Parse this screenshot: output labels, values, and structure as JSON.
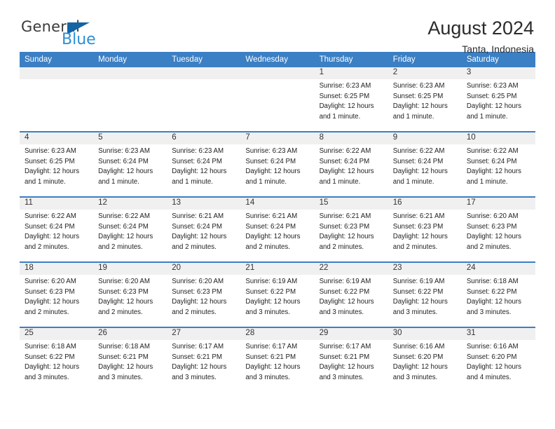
{
  "logo": {
    "word_one": "General",
    "word_two": "Blue",
    "flag_icon": "blue-triangle-flag-icon",
    "color_dark": "#3b3b3b",
    "color_flag": "#1464a5",
    "color_blue": "#2f8fd4"
  },
  "header": {
    "title": "August 2024",
    "location": "Tanta, Indonesia"
  },
  "theme": {
    "header_band": "#3b7fc4",
    "daynum_band": "#f0f0f0",
    "row_divider": "#3b7fc4"
  },
  "calendar": {
    "day_headers": [
      "Sunday",
      "Monday",
      "Tuesday",
      "Wednesday",
      "Thursday",
      "Friday",
      "Saturday"
    ],
    "weeks": [
      [
        {
          "day": ""
        },
        {
          "day": ""
        },
        {
          "day": ""
        },
        {
          "day": ""
        },
        {
          "day": "1",
          "sunrise": "Sunrise: 6:23 AM",
          "sunset": "Sunset: 6:25 PM",
          "daylight": "Daylight: 12 hours and 1 minute."
        },
        {
          "day": "2",
          "sunrise": "Sunrise: 6:23 AM",
          "sunset": "Sunset: 6:25 PM",
          "daylight": "Daylight: 12 hours and 1 minute."
        },
        {
          "day": "3",
          "sunrise": "Sunrise: 6:23 AM",
          "sunset": "Sunset: 6:25 PM",
          "daylight": "Daylight: 12 hours and 1 minute."
        }
      ],
      [
        {
          "day": "4",
          "sunrise": "Sunrise: 6:23 AM",
          "sunset": "Sunset: 6:25 PM",
          "daylight": "Daylight: 12 hours and 1 minute."
        },
        {
          "day": "5",
          "sunrise": "Sunrise: 6:23 AM",
          "sunset": "Sunset: 6:24 PM",
          "daylight": "Daylight: 12 hours and 1 minute."
        },
        {
          "day": "6",
          "sunrise": "Sunrise: 6:23 AM",
          "sunset": "Sunset: 6:24 PM",
          "daylight": "Daylight: 12 hours and 1 minute."
        },
        {
          "day": "7",
          "sunrise": "Sunrise: 6:23 AM",
          "sunset": "Sunset: 6:24 PM",
          "daylight": "Daylight: 12 hours and 1 minute."
        },
        {
          "day": "8",
          "sunrise": "Sunrise: 6:22 AM",
          "sunset": "Sunset: 6:24 PM",
          "daylight": "Daylight: 12 hours and 1 minute."
        },
        {
          "day": "9",
          "sunrise": "Sunrise: 6:22 AM",
          "sunset": "Sunset: 6:24 PM",
          "daylight": "Daylight: 12 hours and 1 minute."
        },
        {
          "day": "10",
          "sunrise": "Sunrise: 6:22 AM",
          "sunset": "Sunset: 6:24 PM",
          "daylight": "Daylight: 12 hours and 1 minute."
        }
      ],
      [
        {
          "day": "11",
          "sunrise": "Sunrise: 6:22 AM",
          "sunset": "Sunset: 6:24 PM",
          "daylight": "Daylight: 12 hours and 2 minutes."
        },
        {
          "day": "12",
          "sunrise": "Sunrise: 6:22 AM",
          "sunset": "Sunset: 6:24 PM",
          "daylight": "Daylight: 12 hours and 2 minutes."
        },
        {
          "day": "13",
          "sunrise": "Sunrise: 6:21 AM",
          "sunset": "Sunset: 6:24 PM",
          "daylight": "Daylight: 12 hours and 2 minutes."
        },
        {
          "day": "14",
          "sunrise": "Sunrise: 6:21 AM",
          "sunset": "Sunset: 6:24 PM",
          "daylight": "Daylight: 12 hours and 2 minutes."
        },
        {
          "day": "15",
          "sunrise": "Sunrise: 6:21 AM",
          "sunset": "Sunset: 6:23 PM",
          "daylight": "Daylight: 12 hours and 2 minutes."
        },
        {
          "day": "16",
          "sunrise": "Sunrise: 6:21 AM",
          "sunset": "Sunset: 6:23 PM",
          "daylight": "Daylight: 12 hours and 2 minutes."
        },
        {
          "day": "17",
          "sunrise": "Sunrise: 6:20 AM",
          "sunset": "Sunset: 6:23 PM",
          "daylight": "Daylight: 12 hours and 2 minutes."
        }
      ],
      [
        {
          "day": "18",
          "sunrise": "Sunrise: 6:20 AM",
          "sunset": "Sunset: 6:23 PM",
          "daylight": "Daylight: 12 hours and 2 minutes."
        },
        {
          "day": "19",
          "sunrise": "Sunrise: 6:20 AM",
          "sunset": "Sunset: 6:23 PM",
          "daylight": "Daylight: 12 hours and 2 minutes."
        },
        {
          "day": "20",
          "sunrise": "Sunrise: 6:20 AM",
          "sunset": "Sunset: 6:23 PM",
          "daylight": "Daylight: 12 hours and 2 minutes."
        },
        {
          "day": "21",
          "sunrise": "Sunrise: 6:19 AM",
          "sunset": "Sunset: 6:22 PM",
          "daylight": "Daylight: 12 hours and 3 minutes."
        },
        {
          "day": "22",
          "sunrise": "Sunrise: 6:19 AM",
          "sunset": "Sunset: 6:22 PM",
          "daylight": "Daylight: 12 hours and 3 minutes."
        },
        {
          "day": "23",
          "sunrise": "Sunrise: 6:19 AM",
          "sunset": "Sunset: 6:22 PM",
          "daylight": "Daylight: 12 hours and 3 minutes."
        },
        {
          "day": "24",
          "sunrise": "Sunrise: 6:18 AM",
          "sunset": "Sunset: 6:22 PM",
          "daylight": "Daylight: 12 hours and 3 minutes."
        }
      ],
      [
        {
          "day": "25",
          "sunrise": "Sunrise: 6:18 AM",
          "sunset": "Sunset: 6:22 PM",
          "daylight": "Daylight: 12 hours and 3 minutes."
        },
        {
          "day": "26",
          "sunrise": "Sunrise: 6:18 AM",
          "sunset": "Sunset: 6:21 PM",
          "daylight": "Daylight: 12 hours and 3 minutes."
        },
        {
          "day": "27",
          "sunrise": "Sunrise: 6:17 AM",
          "sunset": "Sunset: 6:21 PM",
          "daylight": "Daylight: 12 hours and 3 minutes."
        },
        {
          "day": "28",
          "sunrise": "Sunrise: 6:17 AM",
          "sunset": "Sunset: 6:21 PM",
          "daylight": "Daylight: 12 hours and 3 minutes."
        },
        {
          "day": "29",
          "sunrise": "Sunrise: 6:17 AM",
          "sunset": "Sunset: 6:21 PM",
          "daylight": "Daylight: 12 hours and 3 minutes."
        },
        {
          "day": "30",
          "sunrise": "Sunrise: 6:16 AM",
          "sunset": "Sunset: 6:20 PM",
          "daylight": "Daylight: 12 hours and 3 minutes."
        },
        {
          "day": "31",
          "sunrise": "Sunrise: 6:16 AM",
          "sunset": "Sunset: 6:20 PM",
          "daylight": "Daylight: 12 hours and 4 minutes."
        }
      ]
    ]
  }
}
